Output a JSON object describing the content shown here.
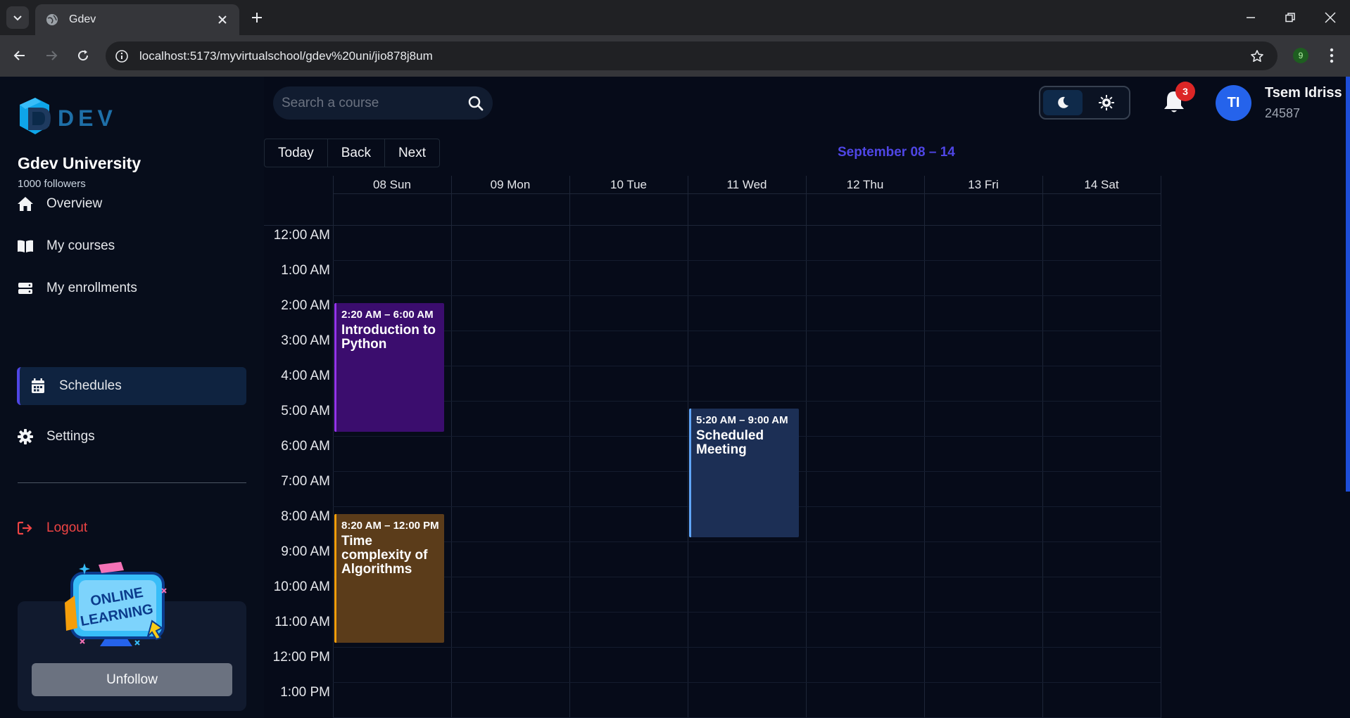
{
  "browser": {
    "tab_title": "Gdev",
    "url": "localhost:5173/myvirtualschool/gdev%20uni/jio878j8um",
    "extension_badge": "9"
  },
  "sidebar": {
    "logo_text": "DEV",
    "org_name": "Gdev University",
    "followers": "1000 followers",
    "items": [
      {
        "label": "Overview",
        "icon": "home-icon"
      },
      {
        "label": "My courses",
        "icon": "book-icon"
      },
      {
        "label": "My enrollments",
        "icon": "stack-icon"
      },
      {
        "label": "Schedules",
        "icon": "calendar-icon",
        "active": true
      },
      {
        "label": "Settings",
        "icon": "gear-icon"
      }
    ],
    "logout_label": "Logout",
    "promo_text_1": "ONLINE",
    "promo_text_2": "LEARNING",
    "unfollow_label": "Unfollow"
  },
  "header": {
    "search_placeholder": "Search a course",
    "notification_count": "3",
    "avatar_initials": "TI",
    "user_name": "Tsem Idriss",
    "user_id": "24587"
  },
  "calendar": {
    "today_label": "Today",
    "back_label": "Back",
    "next_label": "Next",
    "range_label": "September 08 – 14",
    "days": [
      "08 Sun",
      "09 Mon",
      "10 Tue",
      "11 Wed",
      "12 Thu",
      "13 Fri",
      "14 Sat"
    ],
    "times": [
      "12:00 AM",
      "1:00 AM",
      "2:00 AM",
      "3:00 AM",
      "4:00 AM",
      "5:00 AM",
      "6:00 AM",
      "7:00 AM",
      "8:00 AM",
      "9:00 AM",
      "10:00 AM",
      "11:00 AM",
      "12:00 PM",
      "1:00 PM"
    ],
    "events": [
      {
        "time": "2:20 AM – 6:00 AM",
        "title": "Introduction to Python",
        "day_index": 0,
        "start_hour": 2.333,
        "end_hour": 6.0,
        "color": "#3b0d6e",
        "accent": "#9333ea"
      },
      {
        "time": "8:20 AM – 12:00 PM",
        "title": "Time complexity of Algorithms",
        "day_index": 0,
        "start_hour": 8.333,
        "end_hour": 12.0,
        "color": "#5b3c1a",
        "accent": "#f59e0b"
      },
      {
        "time": "5:20 AM – 9:00 AM",
        "title": "Scheduled Meeting",
        "day_index": 3,
        "start_hour": 5.333,
        "end_hour": 9.0,
        "color": "#1c2f55",
        "accent": "#60a5fa"
      }
    ]
  },
  "colors": {
    "accent": "#4f46e5",
    "logout": "#ef4444",
    "badge": "#dc2626",
    "avatar": "#2563eb"
  }
}
